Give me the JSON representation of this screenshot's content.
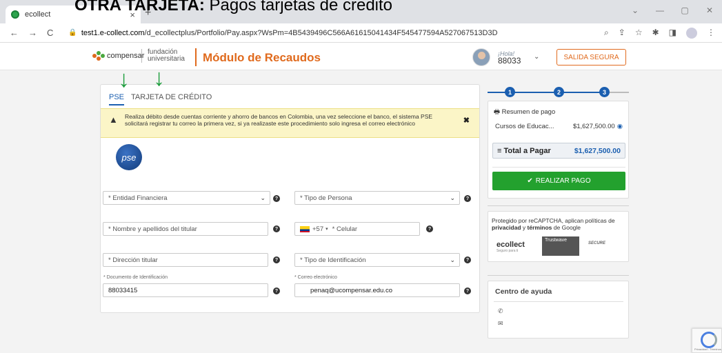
{
  "overlay_title": {
    "bold": "OTRA TARJETA:",
    "rest": " Pagos tarjetas de credito"
  },
  "browser": {
    "tab_title": "ecollect",
    "tab_close": "×",
    "new_tab": "+",
    "url_host": "test1.e-collect.com",
    "url_path": "/d_ecollectplus/Portfolio/Pay.aspx?WsPm=4B5439496C566A61615041434F545477594A527067513D3D",
    "win_min": "—",
    "win_max": "▢",
    "win_close": "✕",
    "win_menu": "⌄"
  },
  "header": {
    "logo_compensar": "compensar",
    "logo_fundacion_line1": "fundación",
    "logo_fundacion_line2": "universitaria",
    "module_title": "Módulo de Recaudos",
    "greeting": "¡Hola!",
    "user_id": "88033",
    "logout_label": "SALIDA SEGURA"
  },
  "payment": {
    "tab_pse": "PSE",
    "tab_credit": "TARJETA DE CRÉDITO",
    "alert_text": "Realiza débito desde cuentas corriente y ahorro de bancos en Colombia, una vez seleccione el banco, el sistema PSE solicitará registrar tu correo la primera vez, si ya realizaste este procedimiento solo ingresa el correo electrónico",
    "pse_logo": "pse",
    "fields": {
      "entidad": "* Entidad Financiera",
      "tipo_persona": "* Tipo de Persona",
      "nombre": "* Nombre y apellidos del titular",
      "country_code": "+57",
      "celular": "* Celular",
      "direccion": "* Dirección titular",
      "tipo_id": "* Tipo de Identificación",
      "doc_label": "* Documento de Identificación",
      "doc_value": "88033415",
      "email_label": "* Correo electrónico",
      "email_value": "penaq@ucompensar.edu.co"
    }
  },
  "steps": [
    "1",
    "2",
    "3"
  ],
  "summary": {
    "title": "Resumen de pago",
    "item_name": "Cursos de Educac...",
    "item_amount": "$1,627,500.00",
    "total_label": "Total a Pagar",
    "total_amount": "$1,627,500.00",
    "pay_button": "REALIZAR PAGO"
  },
  "recaptcha_notice": {
    "pre": "Protegido por reCAPTCHA, aplican políticas de ",
    "privacy": "privacidad",
    "mid": " y ",
    "terms": "términos",
    "post": " de Google",
    "brand_ecollect": "ecollect",
    "brand_ecollect_sub": "Seguro para ti",
    "brand_trustwave": "Trustwave",
    "brand_secure": "SECURE"
  },
  "help": {
    "title": "Centro de ayuda"
  },
  "recaptcha_badge": "Privacidad - Términos"
}
